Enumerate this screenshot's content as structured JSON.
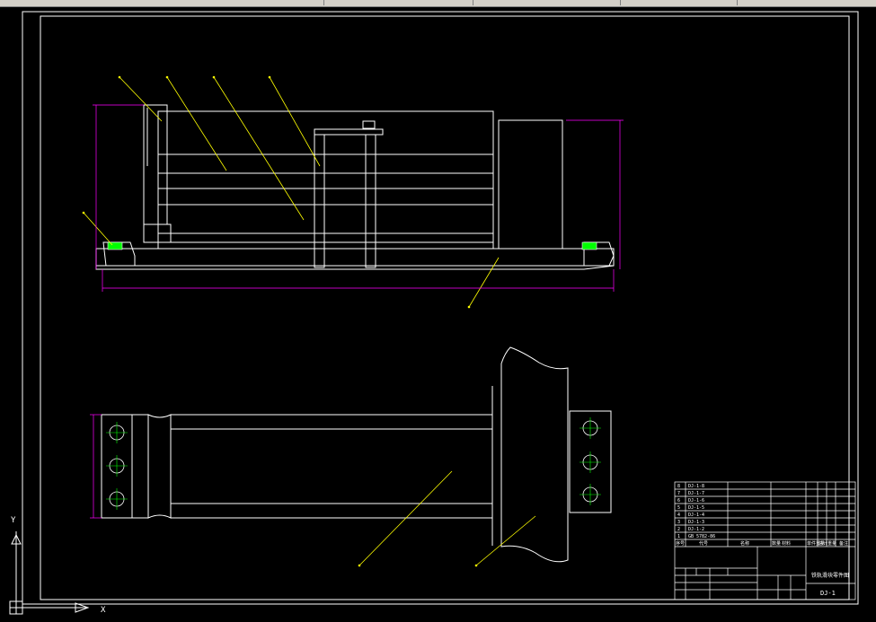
{
  "colors": {
    "background": "#000000",
    "geometry": "#ffffff",
    "leader": "#ffff00",
    "dimension": "#ff00ff",
    "centerline": "#00ff00"
  },
  "ucs": {
    "x_label": "X",
    "y_label": "Y"
  },
  "title_block": {
    "drawing_name": "铁轨滑块零件图",
    "drawing_code": "DJ-1",
    "parts": [
      {
        "no": "8",
        "code": "DJ-1-8"
      },
      {
        "no": "7",
        "code": "DJ-1-7"
      },
      {
        "no": "6",
        "code": "DJ-1-6"
      },
      {
        "no": "5",
        "code": "DJ-1-5"
      },
      {
        "no": "4",
        "code": "DJ-1-4"
      },
      {
        "no": "3",
        "code": "DJ-1-3"
      },
      {
        "no": "2",
        "code": "DJ-1-2"
      },
      {
        "no": "1",
        "code": "GB 5782-86"
      }
    ],
    "header_cells": [
      "序号",
      "代号",
      "名称",
      "数量",
      "材料",
      "单件重量",
      "总计重量",
      "备注"
    ]
  }
}
